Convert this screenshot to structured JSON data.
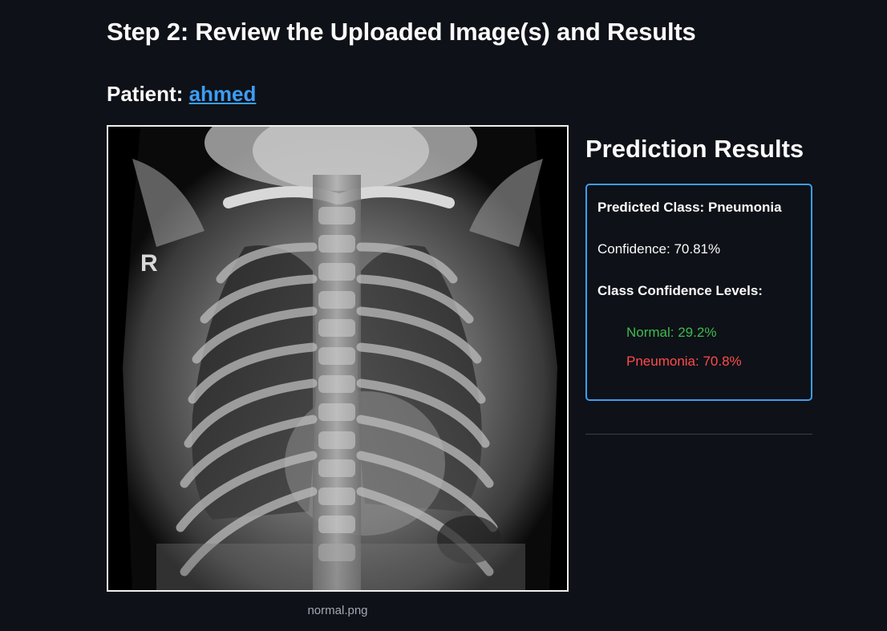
{
  "step": {
    "title": "Step 2: Review the Uploaded Image(s) and Results"
  },
  "patient": {
    "label": "Patient: ",
    "name": "ahmed"
  },
  "image": {
    "caption": "normal.png",
    "marker_letter": "R"
  },
  "results": {
    "title": "Prediction Results",
    "predicted_class": "Predicted Class: Pneumonia",
    "confidence": "Confidence: 70.81%",
    "levels_heading": "Class Confidence Levels:",
    "levels": [
      {
        "label": "Normal: 29.2%",
        "color": "#3dbb4e"
      },
      {
        "label": "Pneumonia: 70.8%",
        "color": "#ff4b4b"
      }
    ]
  },
  "colors": {
    "background": "#0e1117",
    "accent": "#3d9df3",
    "text": "#fafafa"
  }
}
